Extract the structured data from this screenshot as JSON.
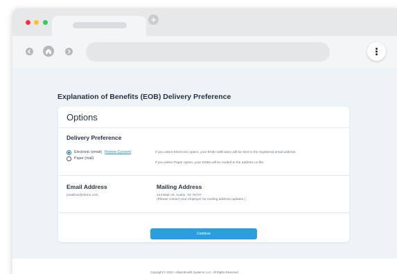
{
  "browser": {
    "new_tab_symbol": "+",
    "icons": [
      "back-icon",
      "home-icon",
      "forward-icon",
      "more-vertical-icon"
    ]
  },
  "page": {
    "title": "Explanation of Benefits (EOB) Delivery Preference"
  },
  "options_card": {
    "title": "Options",
    "delivery": {
      "heading": "Delivery Preference",
      "options": [
        {
          "label": "Electronic (email)",
          "selected": true
        },
        {
          "label": "Paper (mail)",
          "selected": false
        }
      ],
      "review_link": "Review Consent",
      "note_electronic": "If you select Electronic option, your EOB notification will be sent to the registered email address.",
      "note_paper": "If you select Paper option, your EOBs will be mailed to the address on file."
    },
    "email": {
      "heading": "Email Address",
      "value": "jonathan@demo.com"
    },
    "mailing": {
      "heading": "Mailing Address",
      "line1": "123 Main St, Austin, TX 78737",
      "line2": "(Please contact your employer for mailing address updates.)"
    },
    "continue_label": "Continue"
  },
  "footer": {
    "copyright": "Copyright © 2023 - Allied Benefit Systems, LLC. All Rights Reserved."
  },
  "colors": {
    "accent": "#2b9ee0",
    "page_bg": "#eef3f7",
    "traffic_red": "#ff2f3f",
    "traffic_yellow": "#ffc12e",
    "traffic_green": "#2ecc5a"
  }
}
